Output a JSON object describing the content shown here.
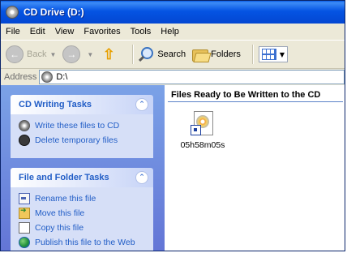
{
  "window": {
    "title": "CD Drive (D:)"
  },
  "menu": [
    "File",
    "Edit",
    "View",
    "Favorites",
    "Tools",
    "Help"
  ],
  "toolbar": {
    "back_label": "Back",
    "search_label": "Search",
    "folders_label": "Folders"
  },
  "address": {
    "label": "Address",
    "value": "D:\\"
  },
  "cd_tasks": {
    "title": "CD Writing Tasks",
    "items": [
      "Write these files to CD",
      "Delete temporary files"
    ]
  },
  "file_tasks": {
    "title": "File and Folder Tasks",
    "items": [
      "Rename this file",
      "Move this file",
      "Copy this file",
      "Publish this file to the Web"
    ]
  },
  "files": {
    "group_header": "Files Ready to Be Written to the CD",
    "items": [
      {
        "name": "05h58m05s"
      }
    ]
  }
}
